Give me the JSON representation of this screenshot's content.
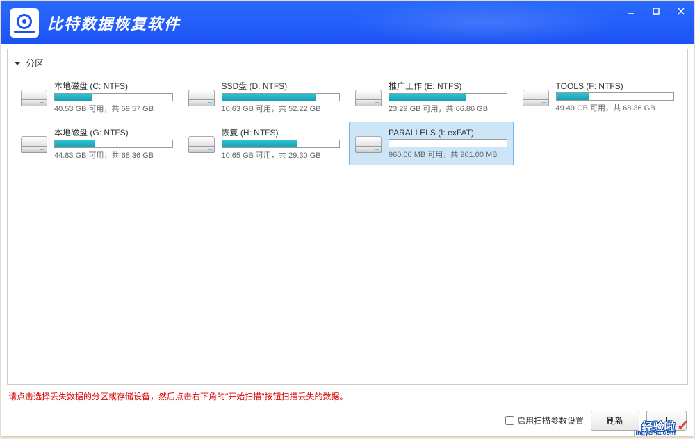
{
  "app": {
    "title": "比特数据恢复软件"
  },
  "section": {
    "label": "分区"
  },
  "drives": [
    {
      "label": "本地磁盘 (C: NTFS)",
      "free": "40.53 GB",
      "total": "59.57 GB",
      "sep": "可用，共",
      "used_pct": 32,
      "selected": false
    },
    {
      "label": "SSD盘 (D: NTFS)",
      "free": "10.63 GB",
      "total": "52.22 GB",
      "sep": "可用，共",
      "used_pct": 80,
      "selected": false
    },
    {
      "label": "推广工作 (E: NTFS)",
      "free": "23.29 GB",
      "total": "66.86 GB",
      "sep": "可用，共",
      "used_pct": 65,
      "selected": false
    },
    {
      "label": "TOOLS (F: NTFS)",
      "free": "49.49 GB",
      "total": "68.36 GB",
      "sep": "可用，共",
      "used_pct": 28,
      "selected": false
    },
    {
      "label": "本地磁盘 (G: NTFS)",
      "free": "44.83 GB",
      "total": "68.36 GB",
      "sep": "可用，共",
      "used_pct": 34,
      "selected": false
    },
    {
      "label": "恢复 (H: NTFS)",
      "free": "10.65 GB",
      "total": "29.30 GB",
      "sep": "可用，共",
      "used_pct": 64,
      "selected": false
    },
    {
      "label": "PARALLELS (I: exFAT)",
      "free": "960.00 MB",
      "total": "961.00 MB",
      "sep": "可用，共",
      "used_pct": 0,
      "selected": true
    }
  ],
  "footer": {
    "hint": "请点击选择丢失数据的分区或存储设备，然后点击右下角的\"开始扫描\"按钮扫描丢失的数据。",
    "checkbox_label": "启用扫描参数设置",
    "refresh_label": "刷新",
    "scan_label": "上"
  },
  "watermark": {
    "text": "经验啦",
    "sub": "jingyanla.com"
  }
}
